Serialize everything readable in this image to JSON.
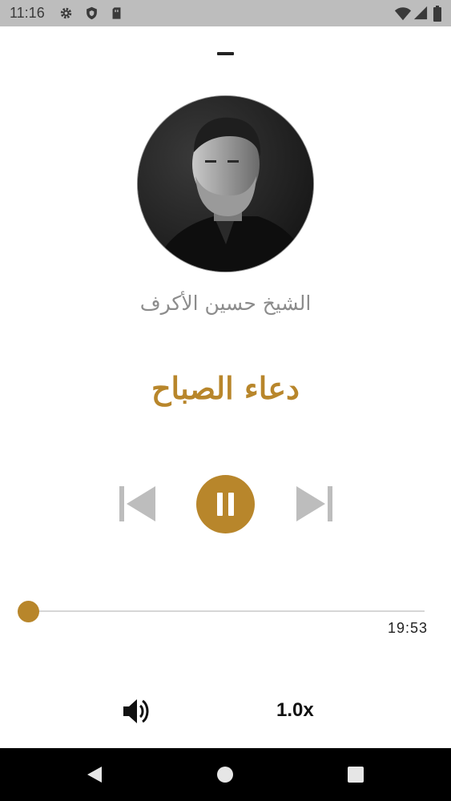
{
  "status_bar": {
    "time": "11:16",
    "left_icons": [
      "gear-icon",
      "shield-icon",
      "sim-card-icon"
    ],
    "right_icons": [
      "wifi-icon",
      "cell-signal-icon",
      "battery-icon"
    ]
  },
  "player": {
    "artist": "الشيخ حسين الأكرف",
    "title": "دعاء الصباح",
    "state": "playing",
    "duration": "19:53",
    "progress": 0,
    "speed": "1.0x",
    "accent_color": "#b8862b"
  },
  "nav_bar": {
    "buttons": [
      "back-icon",
      "home-icon",
      "recents-icon"
    ]
  }
}
